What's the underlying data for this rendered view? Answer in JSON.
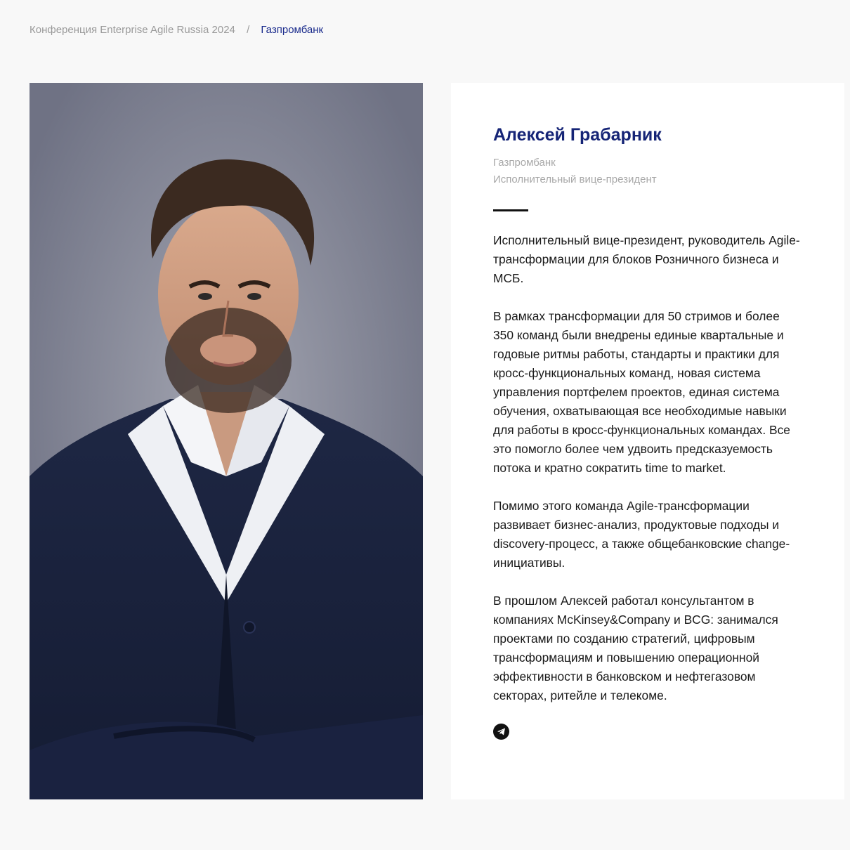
{
  "breadcrumb": {
    "conference": "Конференция Enterprise Agile Russia 2024",
    "separator": "/",
    "current": "Газпромбанк"
  },
  "speaker": {
    "name": "Алексей Грабарник",
    "company": "Газпромбанк",
    "position": "Исполнительный вице-президент",
    "bio": [
      "Исполнительный вице-президент, руководитель Agile-трансформации для блоков Розничного бизнеса и МСБ.",
      "В рамках трансформации для 50 стримов и более 350 команд были внедрены единые квартальные и годовые ритмы работы, стандарты и практики для кросс-функциональных команд, новая система управления портфелем проектов, единая система обучения, охватывающая все необходимые навыки для работы в кросс-функциональных командах. Все это помогло более чем удвоить предсказуемость потока и кратно сократить time to market.",
      "Помимо этого команда Agile-трансформации развивает бизнес-анализ, продуктовые подходы и discovery-процесс, а также общебанковские change-инициативы.",
      "В прошлом Алексей работал консультантом в компаниях McKinsey&Company и BCG: занимался проектами по созданию стратегий, цифровым трансформациям и повышению операционной эффективности в банковском и нефтегазовом секторах, ритейле и телекоме."
    ]
  },
  "social": {
    "telegram_icon": "telegram-icon"
  },
  "colors": {
    "accent": "#152476",
    "breadcrumb_muted": "#9a9a9a",
    "page_bg": "#f8f8f8"
  }
}
